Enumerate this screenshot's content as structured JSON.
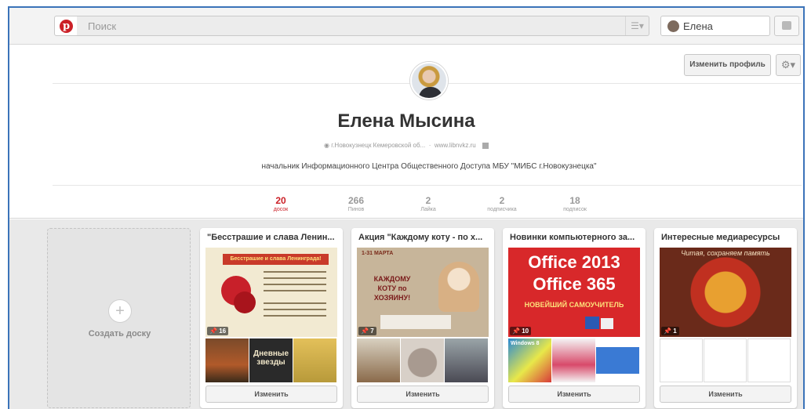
{
  "header": {
    "search_placeholder": "Поиск",
    "user_name": "Елена"
  },
  "profile": {
    "edit_label": "Изменить профиль",
    "name": "Елена Мысина",
    "location": "г.Новокузнецк Кемеровской об...",
    "website": "www.libnvkz.ru",
    "bio": "начальник Информационного Центра Общественного Доступа МБУ \"МИБС г.Новокузнецка\""
  },
  "stats": [
    {
      "value": "20",
      "label": "досок",
      "active": true
    },
    {
      "value": "266",
      "label": "Пинов",
      "active": false
    },
    {
      "value": "2",
      "label": "Лайка",
      "active": false
    },
    {
      "value": "2",
      "label": "подписчика",
      "active": false
    },
    {
      "value": "18",
      "label": "подписок",
      "active": false
    }
  ],
  "create_board_label": "Создать доску",
  "boards": [
    {
      "title": "\"Бесстрашие и слава Ленин...",
      "pins": "16",
      "edit_label": "Изменить",
      "cover_text": "Бесстрашие и слава Ленинграда!",
      "thumb_texts": [
        "",
        "Дневные звезды",
        ""
      ]
    },
    {
      "title": "Акция \"Каждому коту - по х...",
      "pins": "7",
      "edit_label": "Изменить",
      "cover_text": "КАЖДОМУ КОТУ по ХОЗЯИНУ!",
      "cover_date": "1-31 МАРТА"
    },
    {
      "title": "Новинки компьютерного за...",
      "pins": "10",
      "edit_label": "Изменить",
      "cover_line1": "Office 2013",
      "cover_line2": "Office 365",
      "cover_line3": "НОВЕЙШИЙ САМОУЧИТЕЛЬ",
      "thumb_texts": [
        "Windows 8",
        "",
        ""
      ]
    },
    {
      "title": "Интересные медиаресурсы",
      "pins": "1",
      "edit_label": "Изменить",
      "cover_text": "Читая, сохраняем память"
    }
  ]
}
